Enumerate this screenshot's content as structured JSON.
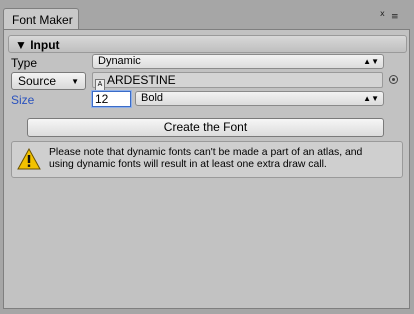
{
  "window": {
    "tab_title": "Font Maker",
    "close_glyph": "x",
    "menu_glyph": "≡"
  },
  "input_section": {
    "header": "▼ Input",
    "type_label": "Type",
    "type_value": "Dynamic",
    "source_button": "Source",
    "source_caret": "▼",
    "font_asset": "ARDESTINE",
    "size_label": "Size",
    "size_value": "12",
    "style_value": "Bold",
    "popup_arrows": "▲▼"
  },
  "create_button": "Create the Font",
  "help": {
    "icon": "warning-icon",
    "line1": "Please note that dynamic fonts can't be made a part of an atlas, and",
    "line2": "using dynamic fonts will result in at least one extra draw call."
  },
  "colors": {
    "size_label": "#2a52be",
    "warning_fill": "#f2c200"
  }
}
